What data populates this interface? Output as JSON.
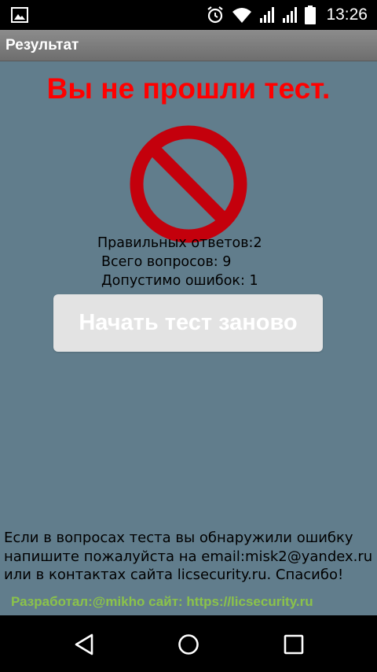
{
  "status_bar": {
    "time": "13:26",
    "icons": [
      "gallery-icon",
      "alarm-icon",
      "wifi-icon",
      "signal-icon",
      "signal-icon",
      "battery-icon"
    ]
  },
  "app_bar": {
    "title": "Результат"
  },
  "result": {
    "headline": "Вы не прошли тест.",
    "headline_color": "#ff0000",
    "icon": "no-entry-icon",
    "icon_color": "#c4000c",
    "stats": {
      "correct": "Правильных ответов:2",
      "total": "Всего вопросов: 9",
      "allowed_errors": "Допустимо ошибок: 1"
    },
    "restart_label": "Начать тест заново"
  },
  "footer": {
    "note": "Если в вопросах теста вы обнаружили ошибку\nнапишите пожалуйста на email:misk2@yandex.ru\nили в контактах сайта licsecurity.ru. Спасибо!",
    "credit": "Разработал:@mikho сайт: https://licsecurity.ru",
    "credit_color": "#8bc34a"
  },
  "colors": {
    "background": "#617d8c",
    "title_bar": "#7d7d7d",
    "button": "#e3e3e3"
  },
  "nav_bar": {
    "buttons": [
      "back-icon",
      "home-icon",
      "recents-icon"
    ]
  }
}
